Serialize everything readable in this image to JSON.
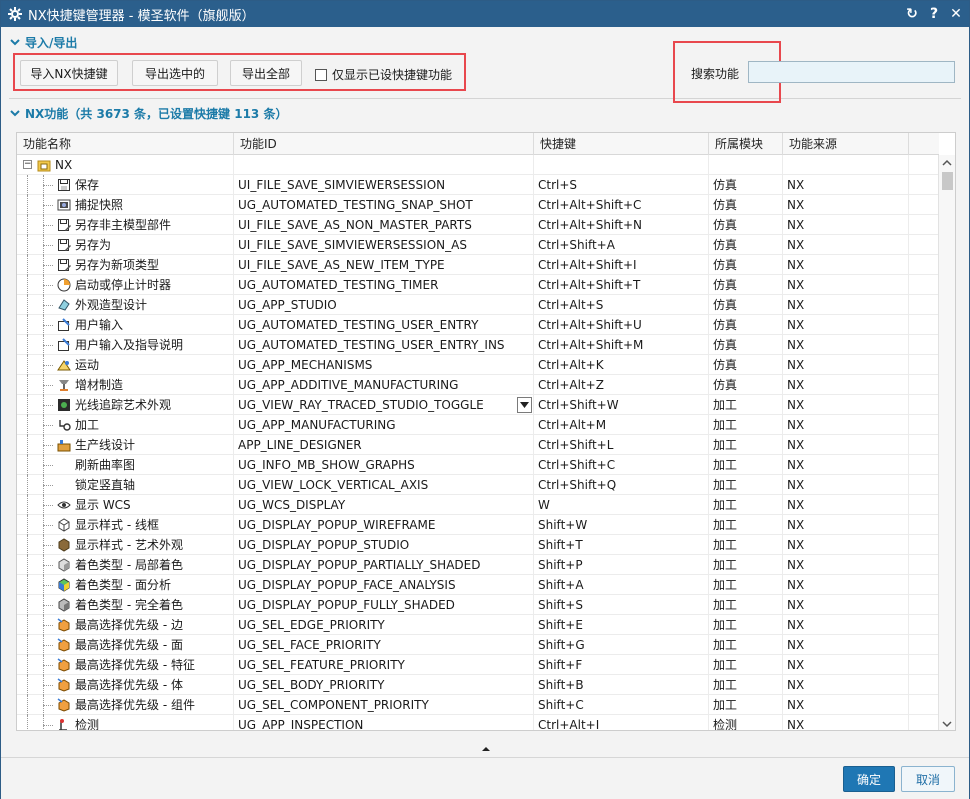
{
  "window": {
    "title": "NX快捷键管理器 - 模圣软件（旗舰版）"
  },
  "title_buttons": {
    "reset": "↻",
    "help": "?",
    "close": "✕"
  },
  "io_section": {
    "title": "导入/导出",
    "import_button": "导入NX快捷键",
    "export_selected_button": "导出选中的",
    "export_all_button": "导出全部",
    "only_shortcut_checkbox": "仅显示已设快捷键功能",
    "only_shortcut_checked": false,
    "search_label": "搜索功能",
    "search_value": ""
  },
  "functions_section": {
    "title": "NX功能（共 3673 条，已设置快捷键 113 条）"
  },
  "table": {
    "columns": [
      "功能名称",
      "功能ID",
      "快捷键",
      "所属模块",
      "功能来源"
    ],
    "root": {
      "label": "NX",
      "icon": "folder-nx-icon"
    },
    "rows": [
      {
        "name": "保存",
        "id": "UI_FILE_SAVE_SIMVIEWERSESSION",
        "shortcut": "Ctrl+S",
        "module": "仿真",
        "source": "NX",
        "icon": "save-icon"
      },
      {
        "name": "捕捉快照",
        "id": "UG_AUTOMATED_TESTING_SNAP_SHOT",
        "shortcut": "Ctrl+Alt+Shift+C",
        "module": "仿真",
        "source": "NX",
        "icon": "snapshot-icon"
      },
      {
        "name": "另存非主模型部件",
        "id": "UI_FILE_SAVE_AS_NON_MASTER_PARTS",
        "shortcut": "Ctrl+Alt+Shift+N",
        "module": "仿真",
        "source": "NX",
        "icon": "save-as-icon"
      },
      {
        "name": "另存为",
        "id": "UI_FILE_SAVE_SIMVIEWERSESSION_AS",
        "shortcut": "Ctrl+Shift+A",
        "module": "仿真",
        "source": "NX",
        "icon": "save-as-icon"
      },
      {
        "name": "另存为新项类型",
        "id": "UI_FILE_SAVE_AS_NEW_ITEM_TYPE",
        "shortcut": "Ctrl+Alt+Shift+I",
        "module": "仿真",
        "source": "NX",
        "icon": "save-as-icon"
      },
      {
        "name": "启动或停止计时器",
        "id": "UG_AUTOMATED_TESTING_TIMER",
        "shortcut": "Ctrl+Alt+Shift+T",
        "module": "仿真",
        "source": "NX",
        "icon": "timer-icon"
      },
      {
        "name": "外观造型设计",
        "id": "UG_APP_STUDIO",
        "shortcut": "Ctrl+Alt+S",
        "module": "仿真",
        "source": "NX",
        "icon": "studio-icon"
      },
      {
        "name": "用户输入",
        "id": "UG_AUTOMATED_TESTING_USER_ENTRY",
        "shortcut": "Ctrl+Alt+Shift+U",
        "module": "仿真",
        "source": "NX",
        "icon": "user-entry-icon"
      },
      {
        "name": "用户输入及指导说明",
        "id": "UG_AUTOMATED_TESTING_USER_ENTRY_INS",
        "shortcut": "Ctrl+Alt+Shift+M",
        "module": "仿真",
        "source": "NX",
        "icon": "user-entry-icon"
      },
      {
        "name": "运动",
        "id": "UG_APP_MECHANISMS",
        "shortcut": "Ctrl+Alt+K",
        "module": "仿真",
        "source": "NX",
        "icon": "motion-icon"
      },
      {
        "name": "增材制造",
        "id": "UG_APP_ADDITIVE_MANUFACTURING",
        "shortcut": "Ctrl+Alt+Z",
        "module": "仿真",
        "source": "NX",
        "icon": "additive-icon"
      },
      {
        "name": "光线追踪艺术外观",
        "id": "UG_VIEW_RAY_TRACED_STUDIO_TOGGLE",
        "shortcut": "Ctrl+Shift+W",
        "module": "加工",
        "source": "NX",
        "icon": "ray-trace-icon",
        "has_dropdown": true
      },
      {
        "name": "加工",
        "id": "UG_APP_MANUFACTURING",
        "shortcut": "Ctrl+Alt+M",
        "module": "加工",
        "source": "NX",
        "icon": "manufacturing-icon"
      },
      {
        "name": "生产线设计",
        "id": "APP_LINE_DESIGNER",
        "shortcut": "Ctrl+Shift+L",
        "module": "加工",
        "source": "NX",
        "icon": "line-designer-icon"
      },
      {
        "name": "刷新曲率图",
        "id": "UG_INFO_MB_SHOW_GRAPHS",
        "shortcut": "Ctrl+Shift+C",
        "module": "加工",
        "source": "NX",
        "icon": ""
      },
      {
        "name": "锁定竖直轴",
        "id": "UG_VIEW_LOCK_VERTICAL_AXIS",
        "shortcut": "Ctrl+Shift+Q",
        "module": "加工",
        "source": "NX",
        "icon": ""
      },
      {
        "name": "显示 WCS",
        "id": "UG_WCS_DISPLAY",
        "shortcut": "W",
        "module": "加工",
        "source": "NX",
        "icon": "eye-icon"
      },
      {
        "name": "显示样式 - 线框",
        "id": "UG_DISPLAY_POPUP_WIREFRAME",
        "shortcut": "Shift+W",
        "module": "加工",
        "source": "NX",
        "icon": "wireframe-icon"
      },
      {
        "name": "显示样式 - 艺术外观",
        "id": "UG_DISPLAY_POPUP_STUDIO",
        "shortcut": "Shift+T",
        "module": "加工",
        "source": "NX",
        "icon": "studio-cube-icon"
      },
      {
        "name": "着色类型 - 局部着色",
        "id": "UG_DISPLAY_POPUP_PARTIALLY_SHADED",
        "shortcut": "Shift+P",
        "module": "加工",
        "source": "NX",
        "icon": "partial-shaded-icon"
      },
      {
        "name": "着色类型 - 面分析",
        "id": "UG_DISPLAY_POPUP_FACE_ANALYSIS",
        "shortcut": "Shift+A",
        "module": "加工",
        "source": "NX",
        "icon": "face-analysis-icon"
      },
      {
        "name": "着色类型 - 完全着色",
        "id": "UG_DISPLAY_POPUP_FULLY_SHADED",
        "shortcut": "Shift+S",
        "module": "加工",
        "source": "NX",
        "icon": "fully-shaded-icon"
      },
      {
        "name": "最高选择优先级 - 边",
        "id": "UG_SEL_EDGE_PRIORITY",
        "shortcut": "Shift+E",
        "module": "加工",
        "source": "NX",
        "icon": "edge-priority-icon"
      },
      {
        "name": "最高选择优先级 - 面",
        "id": "UG_SEL_FACE_PRIORITY",
        "shortcut": "Shift+G",
        "module": "加工",
        "source": "NX",
        "icon": "face-priority-icon"
      },
      {
        "name": "最高选择优先级 - 特征",
        "id": "UG_SEL_FEATURE_PRIORITY",
        "shortcut": "Shift+F",
        "module": "加工",
        "source": "NX",
        "icon": "feature-priority-icon"
      },
      {
        "name": "最高选择优先级 - 体",
        "id": "UG_SEL_BODY_PRIORITY",
        "shortcut": "Shift+B",
        "module": "加工",
        "source": "NX",
        "icon": "body-priority-icon"
      },
      {
        "name": "最高选择优先级 - 组件",
        "id": "UG_SEL_COMPONENT_PRIORITY",
        "shortcut": "Shift+C",
        "module": "加工",
        "source": "NX",
        "icon": "component-priority-icon"
      },
      {
        "name": "检测",
        "id": "UG_APP_INSPECTION",
        "shortcut": "Ctrl+Alt+I",
        "module": "检测",
        "source": "NX",
        "icon": "inspection-icon"
      }
    ]
  },
  "footer": {
    "ok_label": "确定",
    "cancel_label": "取消"
  },
  "colors": {
    "titlebar": "#2b5f8c",
    "accent": "#1c7ba8",
    "ok_button": "#1f77b4",
    "highlight_box": "#e8474d"
  }
}
